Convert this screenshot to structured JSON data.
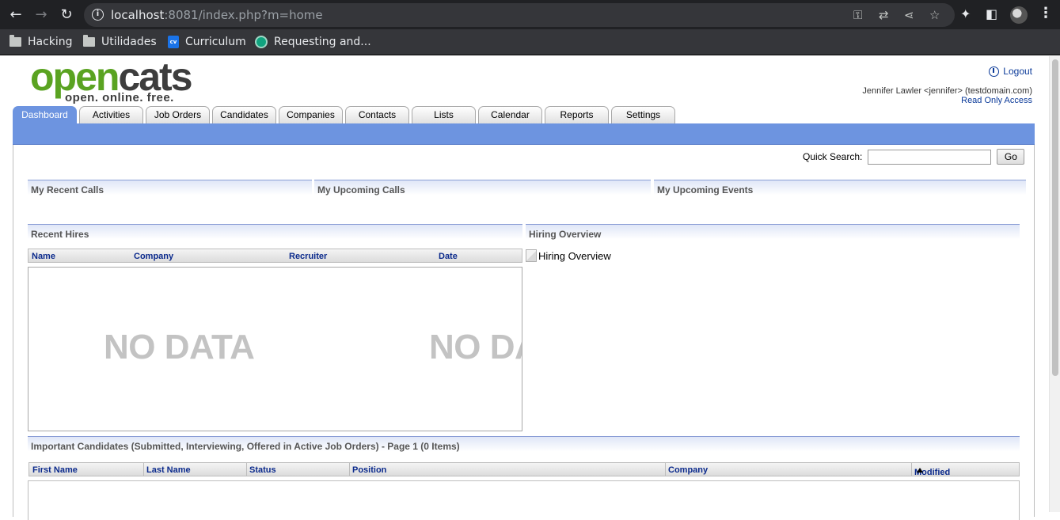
{
  "browser": {
    "url_host": "localhost",
    "url_rest": ":8081/index.php?m=home",
    "bookmarks": [
      "Hacking",
      "Utilidades",
      "Curriculum",
      "Requesting and..."
    ],
    "cv_badge": "cv"
  },
  "app": {
    "logo_open": "open",
    "logo_cats": "cats",
    "logo_tagline": "open. online. free.",
    "logout_label": "Logout",
    "user_line": "Jennifer Lawler <jennifer> (testdomain.com)",
    "access_line": "Read Only Access"
  },
  "tabs": [
    "Dashboard",
    "Activities",
    "Job Orders",
    "Candidates",
    "Companies",
    "Contacts",
    "Lists",
    "Calendar",
    "Reports",
    "Settings"
  ],
  "active_tab": "Dashboard",
  "quick_search": {
    "label": "Quick Search:",
    "value": "",
    "button": "Go"
  },
  "sections": {
    "recent_calls": "My Recent Calls",
    "upcoming_calls": "My Upcoming Calls",
    "upcoming_events": "My Upcoming Events",
    "recent_hires": "Recent Hires",
    "hiring_overview": "Hiring Overview",
    "important_candidates": "Important Candidates (Submitted, Interviewing, Offered in Active Job Orders) - Page 1 (0 Items)"
  },
  "recent_hires_table": {
    "columns": [
      "Name",
      "Company",
      "Recruiter",
      "Date"
    ],
    "no_data_text": "NO DATA"
  },
  "hiring_overview_alt": "Hiring Overview",
  "candidates_table": {
    "columns": [
      "First Name",
      "Last Name",
      "Status",
      "Position",
      "Company",
      "Modified"
    ]
  }
}
